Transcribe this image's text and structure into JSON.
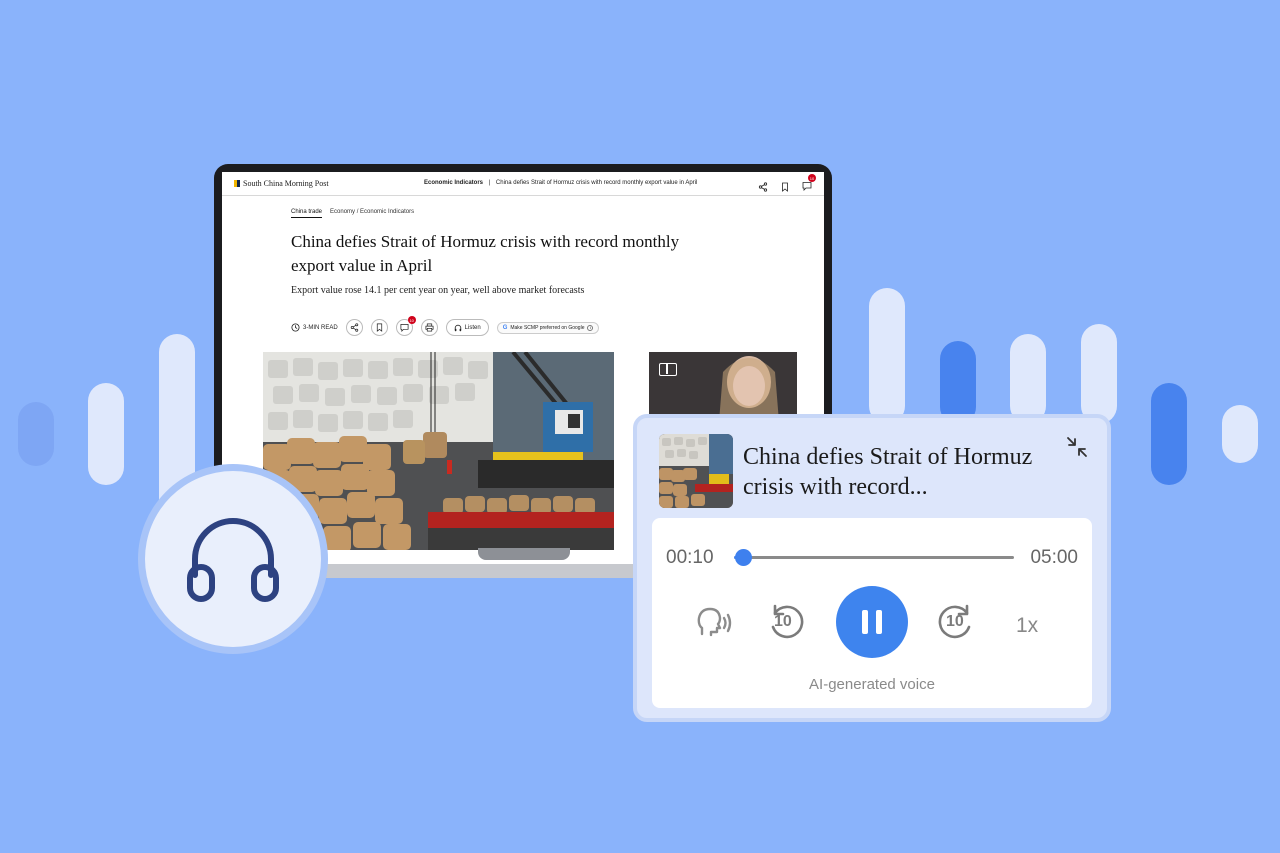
{
  "site": {
    "logo": "South China Morning Post",
    "header_section": "Economic Indicators",
    "header_separator": "|",
    "header_title": "China defies Strait of Hormuz crisis with record monthly export value in April",
    "comment_count": "10"
  },
  "article": {
    "tag_active": "China trade",
    "breadcrumb": "Economy / Economic Indicators",
    "headline": "China defies Strait of Hormuz crisis with record monthly export value in April",
    "standfirst": "Export value rose 14.1 per cent year on year, well above market forecasts",
    "read_time": "3-MIN READ",
    "comment_count": "10",
    "listen_label": "Listen",
    "google_pref": "Make SCMP preferred on Google"
  },
  "player": {
    "title": "China defies Strait of Hormuz crisis with record...",
    "current_time": "00:10",
    "total_time": "05:00",
    "progress": 0.033,
    "skip_back": "10",
    "skip_forward": "10",
    "speed": "1x",
    "voice_label": "AI-generated voice"
  },
  "colors": {
    "background": "#8ab3fb",
    "accent": "#3e84ee",
    "player_bg": "#dde6fb"
  },
  "icons": [
    "headphones-icon",
    "share-icon",
    "bookmark-icon",
    "comment-icon",
    "print-icon",
    "clock-icon",
    "collapse-icon",
    "voice-icon",
    "rewind-10-icon",
    "pause-icon",
    "forward-10-icon"
  ]
}
